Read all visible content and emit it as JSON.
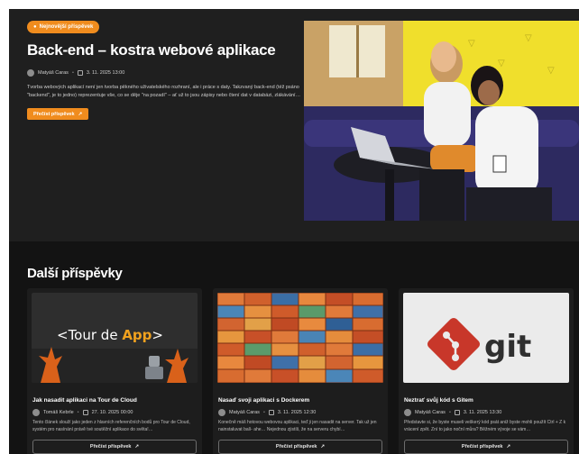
{
  "hero": {
    "badge": "Nejnovější příspěvek",
    "title": "Back-end – kostra webové aplikace",
    "author": "Matyáš Caras",
    "date": "3. 11. 2025 13:00",
    "excerpt": "Tvorba webových aplikací není jen tvorba pěkného uživatelského rozhraní, ale i práce s daty. Takzvaný back-end (též psáno \"backend\", je to jedno) reprezentuje vše, co se děje \"na pozadí\" – ať už to jsou zápisy nebo čtení dat v databázi, zlákávání…",
    "button_label": "Přečíst příspěvek"
  },
  "section_title": "Další příspěvky",
  "cards": [
    {
      "image_text_a": "<Tour de ",
      "image_text_b": "App",
      "image_text_c": ">",
      "title": "Jak nasadit aplikaci na Tour de Cloud",
      "author": "Tomáš Kebrle",
      "date": "27. 10. 2025 00:00",
      "excerpt": "Tento článek slouží jako jeden z hlavních referenčních bodů pro Tour de Cloud, systém pro nasínání právě tvé soutěžní aplikace do světa!…",
      "button_label": "Přečíst příspěvek"
    },
    {
      "title": "Nasaď svoji aplikaci s Dockerem",
      "author": "Matyáš Caras",
      "date": "3. 11. 2025 12:30",
      "excerpt": "Konečně máš hotovou webovou aplikaci, teď ji jen nasadit na server. Tak už jen nainstaluvat balí- ahe… Nejednou zjistíš, že na serveru chybí…",
      "button_label": "Přečíst příspěvek"
    },
    {
      "image_text": "git",
      "title": "Neztrať svůj kód s Gitem",
      "author": "Matyáš Caras",
      "date": "3. 11. 2025 13:30",
      "excerpt": "Představte si, že byste museli veškerý kód psát aniž byste mohli použít Ctrl + Z k vrácení zpět. Zní to jako noční můra? Běžném vývoje se vám…",
      "button_label": "Přečíst příspěvek"
    }
  ],
  "colors": {
    "accent": "#f08c1e",
    "background": "#131313",
    "panel": "#1f1f1f"
  }
}
